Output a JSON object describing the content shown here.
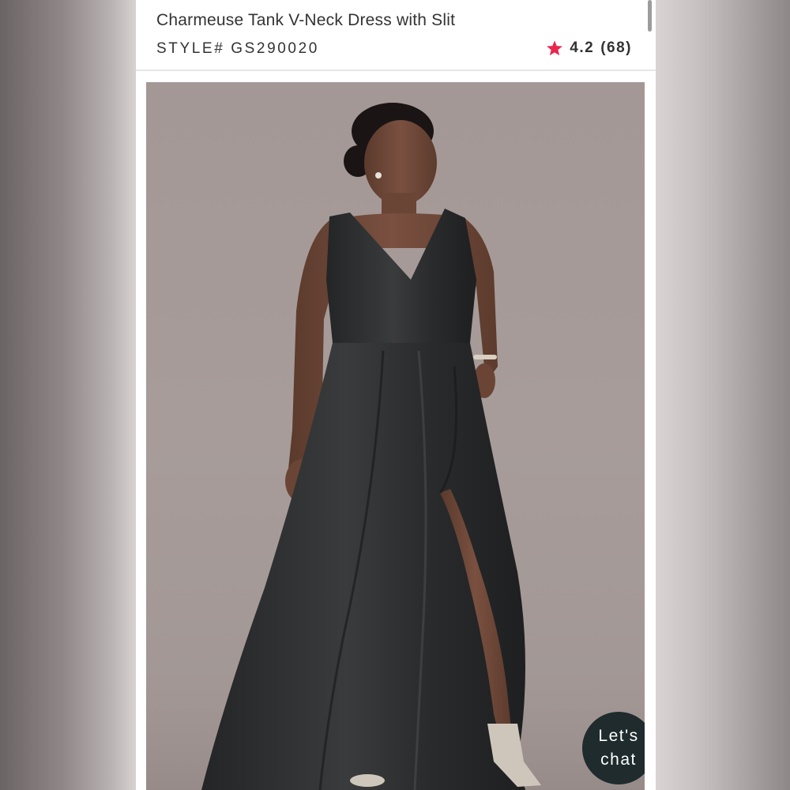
{
  "product": {
    "title": "Charmeuse Tank V-Neck Dress with Slit",
    "style_label": "STYLE#",
    "style_number": "GS290020",
    "rating": "4.2",
    "review_count": "(68)"
  },
  "chat": {
    "line1": "Let's",
    "line2": "chat"
  },
  "colors": {
    "star": "#e8274f",
    "chat_bg": "#1f2b2c",
    "dress": "#2b2c2d",
    "backdrop": "#a59997"
  },
  "icons": {
    "rating_star": "star-icon"
  }
}
